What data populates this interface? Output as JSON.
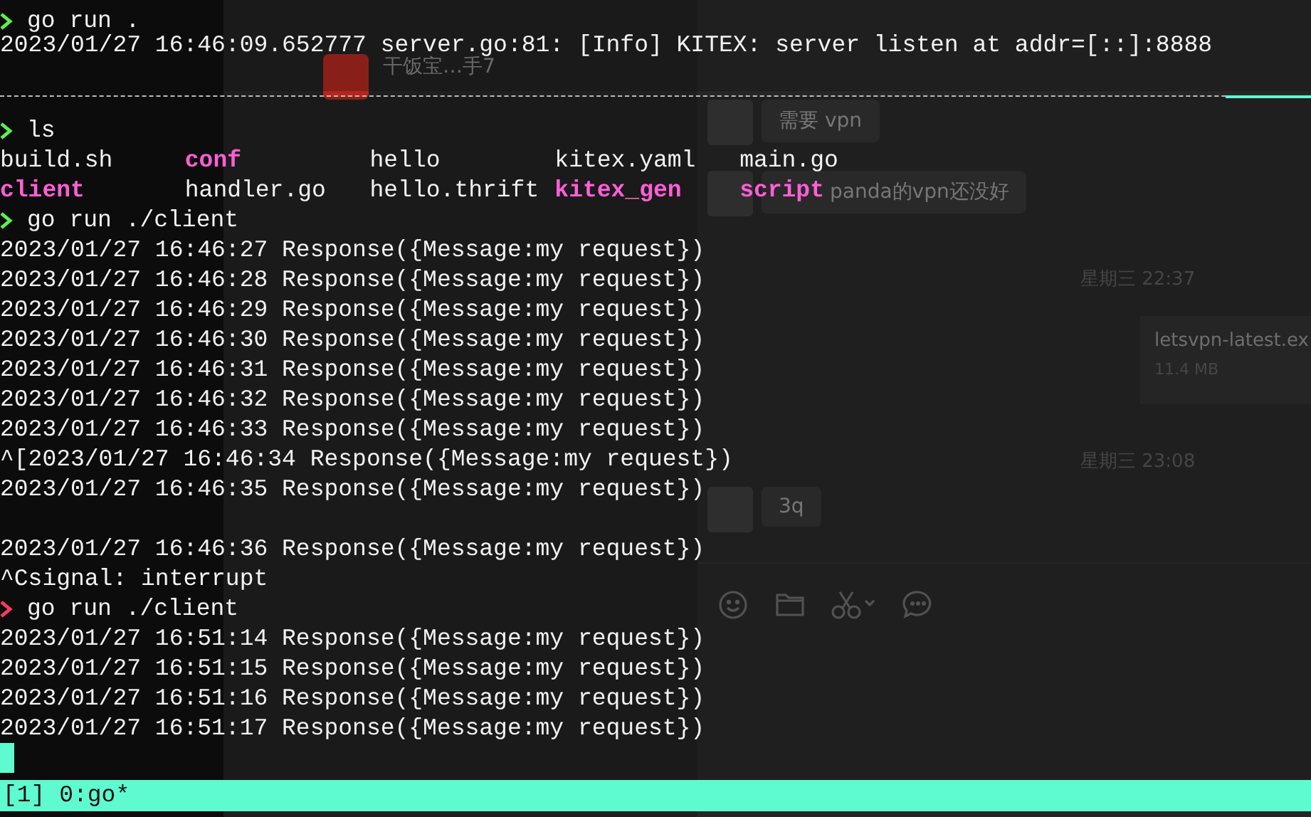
{
  "backdrop": {
    "list": [
      {
        "title": "干饭宝…手7"
      }
    ],
    "messages": [
      {
        "kind": "bubble",
        "text": "需要 vpn"
      },
      {
        "kind": "bubble",
        "text": "panda的vpn还没好"
      },
      {
        "kind": "time",
        "text": "星期三 22:37"
      },
      {
        "kind": "file",
        "text": "letsvpn-latest.ex",
        "size": "11.4 MB"
      },
      {
        "kind": "time",
        "text": "星期三 23:08"
      },
      {
        "kind": "bubble",
        "text": "3q"
      }
    ]
  },
  "top_pane": {
    "lines": [
      {
        "kind": "prompt",
        "error": false,
        "text": "go run ."
      },
      {
        "kind": "output",
        "text": "2023/01/27 16:46:09.652777 server.go:81: [Info] KITEX: server listen at addr=[::]:8888"
      }
    ]
  },
  "bottom_pane": {
    "lines": [
      {
        "kind": "prompt",
        "error": false,
        "text": "ls"
      },
      {
        "kind": "ls",
        "entries": [
          {
            "name": "build.sh",
            "directory": false
          },
          {
            "name": "conf",
            "directory": true
          },
          {
            "name": "hello",
            "directory": false
          },
          {
            "name": "kitex.yaml",
            "directory": false
          },
          {
            "name": "main.go",
            "directory": false
          }
        ]
      },
      {
        "kind": "ls",
        "entries": [
          {
            "name": "client",
            "directory": true
          },
          {
            "name": "handler.go",
            "directory": false
          },
          {
            "name": "hello.thrift",
            "directory": false
          },
          {
            "name": "kitex_gen",
            "directory": true
          },
          {
            "name": "script",
            "directory": true
          }
        ]
      },
      {
        "kind": "prompt",
        "error": false,
        "text": "go run ./client"
      },
      {
        "kind": "output",
        "text": "2023/01/27 16:46:27 Response({Message:my request})"
      },
      {
        "kind": "output",
        "text": "2023/01/27 16:46:28 Response({Message:my request})"
      },
      {
        "kind": "output",
        "text": "2023/01/27 16:46:29 Response({Message:my request})"
      },
      {
        "kind": "output",
        "text": "2023/01/27 16:46:30 Response({Message:my request})"
      },
      {
        "kind": "output",
        "text": "2023/01/27 16:46:31 Response({Message:my request})"
      },
      {
        "kind": "output",
        "text": "2023/01/27 16:46:32 Response({Message:my request})"
      },
      {
        "kind": "output",
        "text": "2023/01/27 16:46:33 Response({Message:my request})"
      },
      {
        "kind": "output",
        "text": "^[2023/01/27 16:46:34 Response({Message:my request})"
      },
      {
        "kind": "output",
        "text": "2023/01/27 16:46:35 Response({Message:my request})"
      },
      {
        "kind": "blank"
      },
      {
        "kind": "output",
        "text": "2023/01/27 16:46:36 Response({Message:my request})"
      },
      {
        "kind": "output",
        "text": "^Csignal: interrupt"
      },
      {
        "kind": "prompt",
        "error": true,
        "text": "go run ./client"
      },
      {
        "kind": "output",
        "text": "2023/01/27 16:51:14 Response({Message:my request})"
      },
      {
        "kind": "output",
        "text": "2023/01/27 16:51:15 Response({Message:my request})"
      },
      {
        "kind": "output",
        "text": "2023/01/27 16:51:16 Response({Message:my request})"
      },
      {
        "kind": "output",
        "text": "2023/01/27 16:51:17 Response({Message:my request})"
      },
      {
        "kind": "cursor"
      }
    ]
  },
  "status_bar": {
    "text": "[1] 0:go*"
  }
}
